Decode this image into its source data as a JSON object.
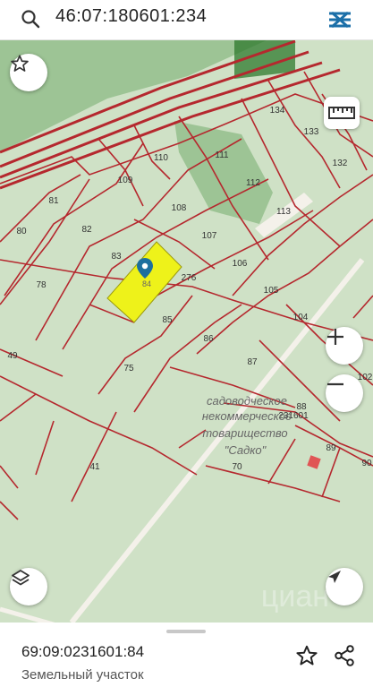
{
  "search": {
    "query": "46:07:180601:234"
  },
  "map": {
    "colors": {
      "background": "#cfe1c6",
      "parcel_line": "#b5282e",
      "selected_fill": "#eef21a",
      "forest": "#3f8f3a"
    },
    "parcel_labels": [
      "134",
      "133",
      "110",
      "111",
      "132",
      "109",
      "112",
      "81",
      "108",
      "113",
      "80",
      "82",
      "107",
      "83",
      "84",
      "106",
      "276",
      "78",
      "105",
      "104",
      "85",
      "86",
      "49",
      "87",
      "75",
      "102",
      "88",
      "231601",
      "89",
      "70",
      "41",
      "90"
    ],
    "marker_label": "84",
    "area_label": [
      "садоводческое",
      "некоммерческое",
      "товарищество",
      "\"Садко\""
    ],
    "watermark": "циан"
  },
  "parcel": {
    "cadastral_number": "69:09:0231601:84",
    "type": "Земельный участок"
  }
}
